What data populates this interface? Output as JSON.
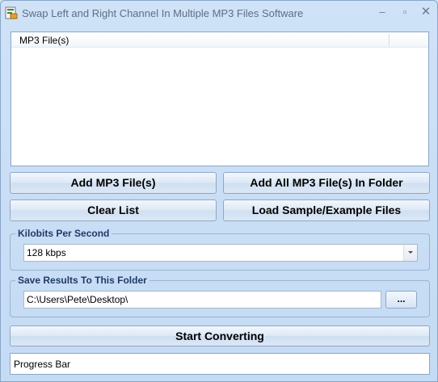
{
  "window": {
    "title": "Swap Left and Right Channel In Multiple MP3 Files Software",
    "minimize_glyph": "–",
    "maximize_glyph": "▫",
    "close_glyph": "✕"
  },
  "file_list": {
    "column_header": "MP3 File(s)",
    "rows": []
  },
  "buttons": {
    "add_files": "Add MP3 File(s)",
    "add_folder": "Add All MP3 File(s) In Folder",
    "clear_list": "Clear List",
    "load_samples": "Load Sample/Example Files",
    "start": "Start Converting"
  },
  "bitrate": {
    "legend": "Kilobits Per Second",
    "selected": "128 kbps"
  },
  "output": {
    "legend": "Save Results To This Folder",
    "path": "C:\\Users\\Pete\\Desktop\\",
    "browse_label": "..."
  },
  "progress": {
    "label": "Progress Bar"
  },
  "colors": {
    "window_bg": "#c4dbf4",
    "legend_text": "#1e3b66",
    "border": "#8aa6c6"
  }
}
